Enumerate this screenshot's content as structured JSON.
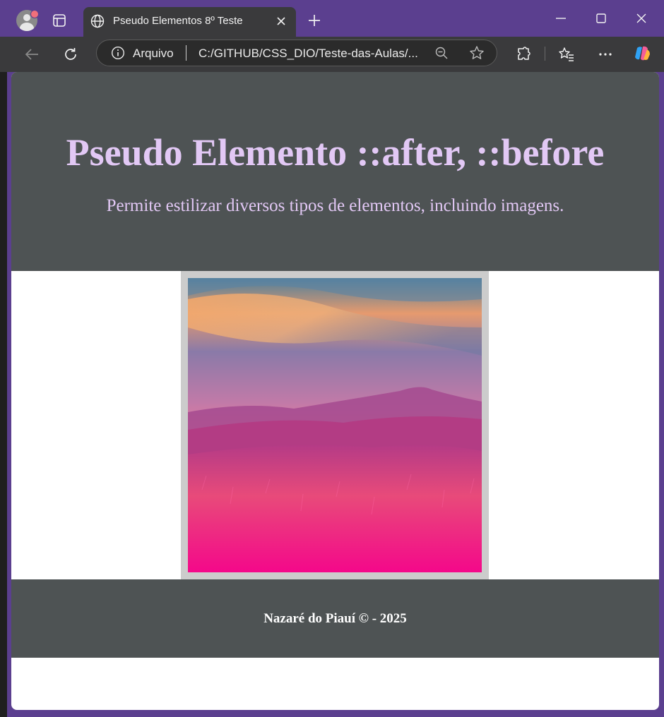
{
  "browser": {
    "tab": {
      "title": "Pseudo Elementos 8º Teste"
    },
    "address_bar": {
      "label": "Arquivo",
      "url": "C:/GITHUB/CSS_DIO/Teste-das-Aulas/..."
    },
    "accent_color": "#5b3f8f"
  },
  "page": {
    "header": {
      "title": "Pseudo Elemento ::after, ::before",
      "subtitle": "Permite estilizar diversos tipos de elementos, incluindo imagens.",
      "background": "#4e5354",
      "text_color": "#e2c8f5"
    },
    "image": {
      "frame_color": "#cccccc"
    },
    "footer": {
      "text": "Nazaré do Piauí © - 2025"
    }
  }
}
